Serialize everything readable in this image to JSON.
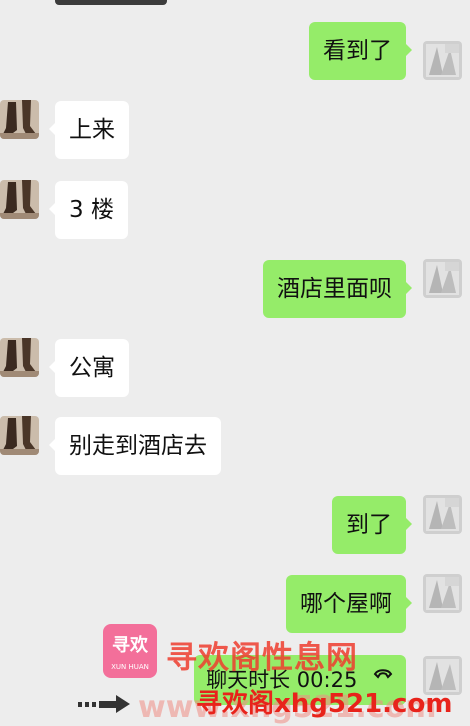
{
  "messages": [
    {
      "side": "out",
      "text": "看到了"
    },
    {
      "side": "in",
      "text": "上来"
    },
    {
      "side": "in",
      "text": "3 楼"
    },
    {
      "side": "out",
      "text": "酒店里面呗"
    },
    {
      "side": "in",
      "text": "公寓"
    },
    {
      "side": "in",
      "text": "别走到酒店去"
    },
    {
      "side": "out",
      "text": "到了"
    },
    {
      "side": "out",
      "text": "哪个屋啊"
    }
  ],
  "call": {
    "text": "聊天时长 00:25",
    "icon": "phone-icon"
  },
  "watermark": {
    "brand": "寻欢阁性息网",
    "site": "寻欢阁xhg521.com",
    "faint": "www.xhg521.com",
    "logo_text": "寻欢",
    "logo_sub": "XUN HUAN"
  },
  "colors": {
    "background": "#ededed",
    "incoming": "#ffffff",
    "outgoing": "#95ec69",
    "watermark": "#e8231b"
  }
}
